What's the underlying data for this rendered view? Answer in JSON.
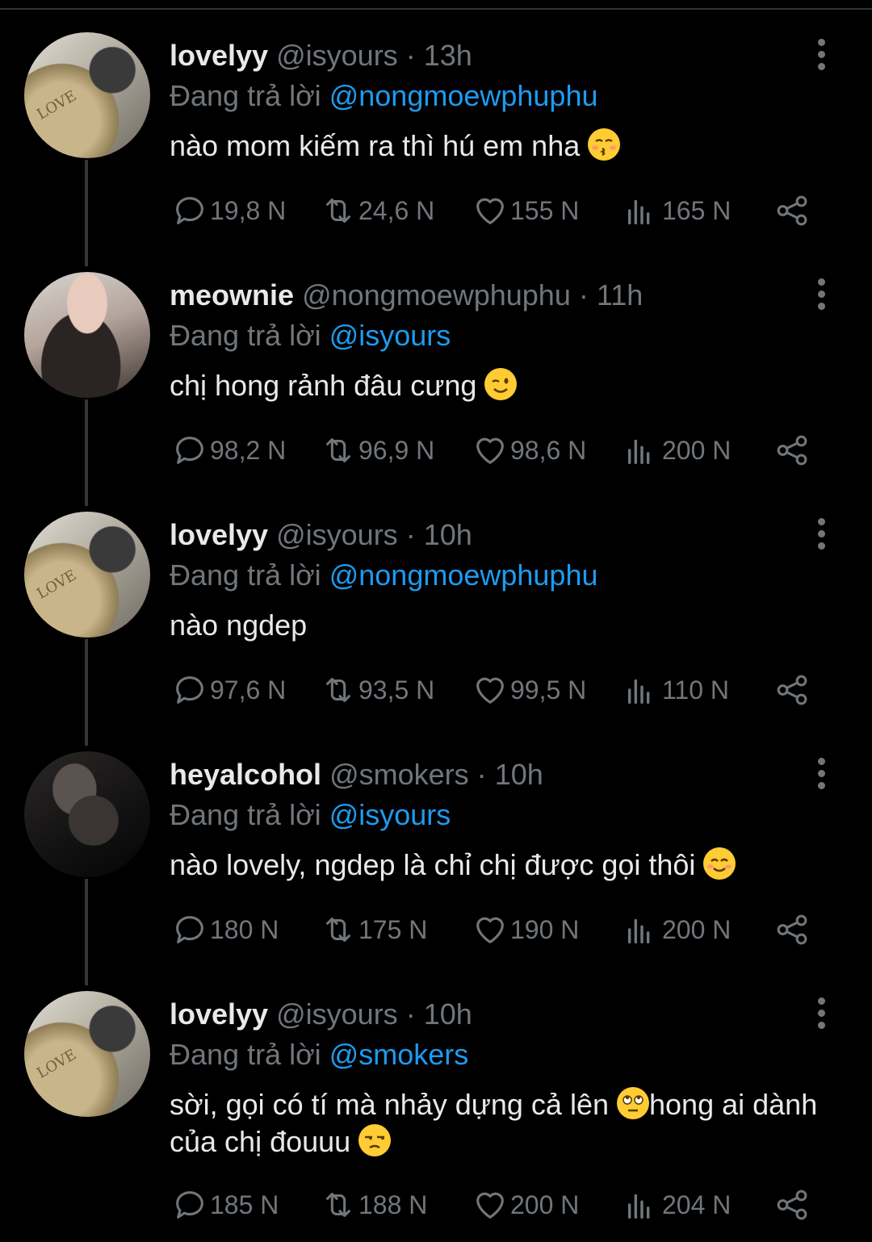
{
  "reply_prefix": "Đang trả lời",
  "tweets": [
    {
      "name": "lovelyy",
      "handle": "@isyours",
      "dot": "·",
      "time": "13h",
      "reply_to": "@nongmoewphuphu",
      "text": "nào mom kiếm ra thì hú em nha",
      "emoji": "kissing-face",
      "stats": {
        "replies": "19,8 N",
        "retweets": "24,6 N",
        "likes": "155 N",
        "views": "165 N"
      }
    },
    {
      "name": "meownie",
      "handle": "@nongmoewphuphu",
      "dot": "·",
      "time": "11h",
      "reply_to": "@isyours",
      "text": "chị hong rảnh đâu cưng",
      "emoji": "winking-face",
      "stats": {
        "replies": "98,2 N",
        "retweets": "96,9 N",
        "likes": "98,6 N",
        "views": "200 N"
      }
    },
    {
      "name": "lovelyy",
      "handle": "@isyours",
      "dot": "·",
      "time": "10h",
      "reply_to": "@nongmoewphuphu",
      "text": "nào ngdep",
      "stats": {
        "replies": "97,6 N",
        "retweets": "93,5 N",
        "likes": "99,5 N",
        "views": "110 N"
      }
    },
    {
      "name": "heyalcohol",
      "handle": "@smokers",
      "dot": "·",
      "time": "10h",
      "reply_to": "@isyours",
      "text": "nào lovely, ngdep là chỉ chị được gọi thôi",
      "emoji": "smiling-face",
      "stats": {
        "replies": "180 N",
        "retweets": "175 N",
        "likes": "190 N",
        "views": "200 N"
      }
    },
    {
      "name": "lovelyy",
      "handle": "@isyours",
      "dot": "·",
      "time": "10h",
      "reply_to": "@smokers",
      "text_part1": "sời, gọi có tí mà nhảy dựng cả lên",
      "text_part2": "hong ai dành của chị đouuu",
      "emoji1": "eye-roll-face",
      "emoji2": "unamused-face",
      "stats": {
        "replies": "185 N",
        "retweets": "188 N",
        "likes": "200 N",
        "views": "204 N"
      }
    }
  ],
  "colors": {
    "background": "#000000",
    "text": "#e7e9ea",
    "muted": "#71767b",
    "link": "#1d9bf0",
    "thread_line": "#333639"
  }
}
